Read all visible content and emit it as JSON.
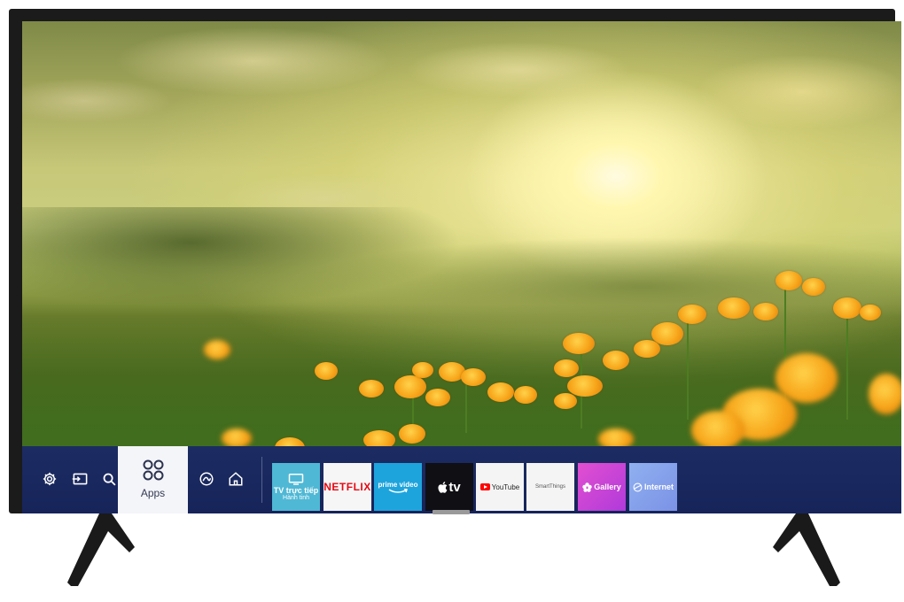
{
  "hub": {
    "settings_icon": "gear-icon",
    "source_icon": "source-input-icon",
    "search_icon": "search-icon",
    "apps": {
      "label": "Apps",
      "icon": "apps-grid-icon"
    },
    "ambient_icon": "ambient-mode-icon",
    "home_icon": "home-icon",
    "tiles": [
      {
        "id": "live-tv",
        "line1": "TV trực tiếp",
        "line2": "Hành tinh",
        "icon": "tv-icon"
      },
      {
        "id": "netflix",
        "label": "NETFLIX"
      },
      {
        "id": "prime-video",
        "label": "prime video"
      },
      {
        "id": "apple-tv",
        "label": "tv",
        "icon": "apple-logo-icon"
      },
      {
        "id": "youtube",
        "label": "YouTube",
        "icon": "youtube-play-icon"
      },
      {
        "id": "smartthings",
        "label": "SmartThings"
      },
      {
        "id": "gallery",
        "label": "Gallery",
        "icon": "flower-icon"
      },
      {
        "id": "internet",
        "label": "Internet",
        "icon": "globe-icon"
      }
    ]
  },
  "colors": {
    "hub_background": "#1c2c62",
    "netflix_red": "#e50914",
    "prime_blue": "#1ea4dd",
    "gallery_magenta": "#d64bd6",
    "internet_blue": "#8aa4ec"
  }
}
